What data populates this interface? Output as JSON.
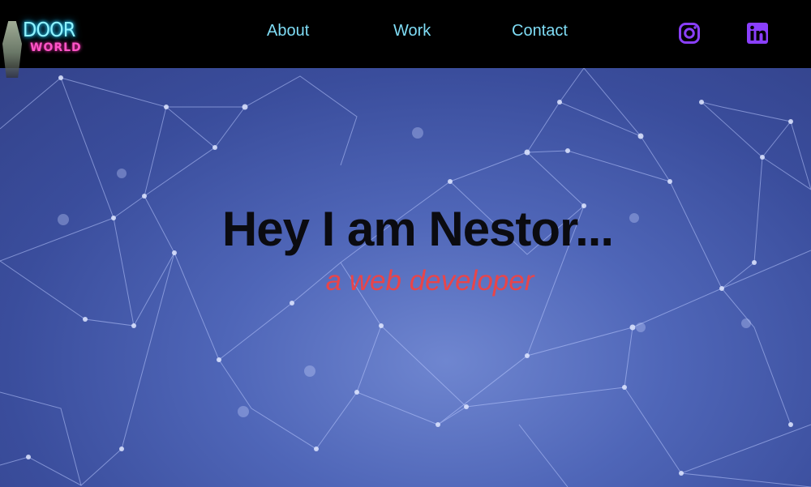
{
  "logo": {
    "line1": "DOOR",
    "line2": "WORLD"
  },
  "nav": {
    "items": [
      {
        "label": "About"
      },
      {
        "label": "Work"
      },
      {
        "label": "Contact"
      }
    ]
  },
  "social": {
    "instagram_icon": "instagram-icon",
    "linkedin_icon": "linkedin-icon",
    "accent": "#8a3ffc"
  },
  "hero": {
    "title": "Hey I am Nestor...",
    "subtitle": "a web developer"
  },
  "colors": {
    "topbar": "#000000",
    "nav_text": "#7fdcf5",
    "hero_title": "#0b0b10",
    "hero_subtitle": "#e8454a",
    "hero_bg": "#4f66b8"
  }
}
